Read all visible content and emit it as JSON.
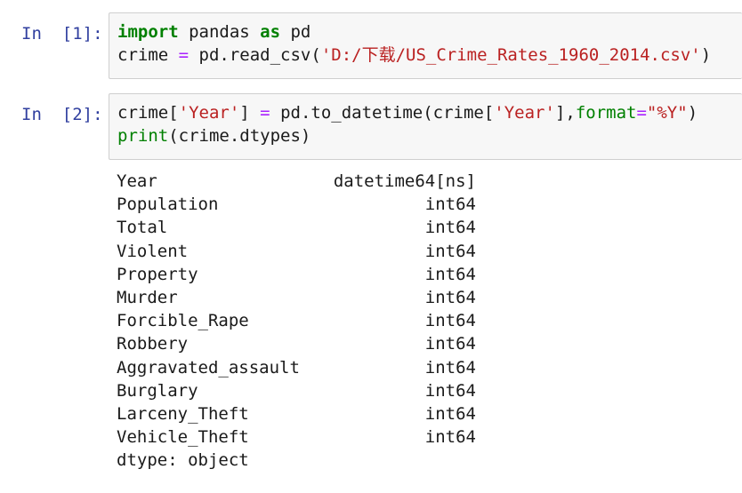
{
  "cells": [
    {
      "prompt": "In  [1]:",
      "lines": [
        [
          {
            "t": "import",
            "c": "kw"
          },
          {
            "t": " pandas ",
            "c": ""
          },
          {
            "t": "as",
            "c": "kw"
          },
          {
            "t": " pd",
            "c": ""
          }
        ],
        [
          {
            "t": "crime ",
            "c": ""
          },
          {
            "t": "=",
            "c": "op"
          },
          {
            "t": " pd.read_csv(",
            "c": ""
          },
          {
            "t": "'D:/下载/US_Crime_Rates_1960_2014.csv'",
            "c": "str"
          },
          {
            "t": ")",
            "c": ""
          }
        ]
      ]
    },
    {
      "prompt": "In  [2]:",
      "lines": [
        [
          {
            "t": "crime[",
            "c": ""
          },
          {
            "t": "'Year'",
            "c": "str"
          },
          {
            "t": "] ",
            "c": ""
          },
          {
            "t": "=",
            "c": "op"
          },
          {
            "t": " pd.to_datetime(crime[",
            "c": ""
          },
          {
            "t": "'Year'",
            "c": "str"
          },
          {
            "t": "],",
            "c": ""
          },
          {
            "t": "format",
            "c": "fn"
          },
          {
            "t": "=",
            "c": "op"
          },
          {
            "t": "\"%Y\"",
            "c": "str"
          },
          {
            "t": ")",
            "c": ""
          }
        ],
        [
          {
            "t": "print",
            "c": "fn"
          },
          {
            "t": "(crime.dtypes)",
            "c": ""
          }
        ]
      ]
    }
  ],
  "output": {
    "rows": [
      {
        "name": "Year",
        "type": "datetime64[ns]"
      },
      {
        "name": "Population",
        "type": "int64"
      },
      {
        "name": "Total",
        "type": "int64"
      },
      {
        "name": "Violent",
        "type": "int64"
      },
      {
        "name": "Property",
        "type": "int64"
      },
      {
        "name": "Murder",
        "type": "int64"
      },
      {
        "name": "Forcible_Rape",
        "type": "int64"
      },
      {
        "name": "Robbery",
        "type": "int64"
      },
      {
        "name": "Aggravated_assault",
        "type": "int64"
      },
      {
        "name": "Burglary",
        "type": "int64"
      },
      {
        "name": "Larceny_Theft",
        "type": "int64"
      },
      {
        "name": "Vehicle_Theft",
        "type": "int64"
      }
    ],
    "footer": "dtype: object"
  }
}
